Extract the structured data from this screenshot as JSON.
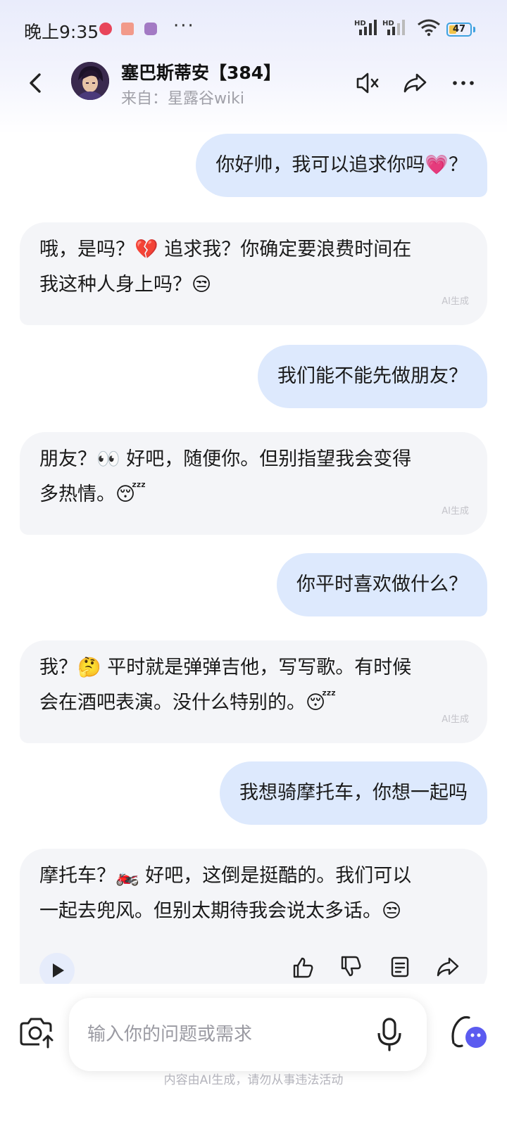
{
  "status_bar": {
    "time": "晚上9:35",
    "signal1_label": "HD",
    "signal2_label": "HD",
    "battery": "47",
    "more": "···"
  },
  "header": {
    "title": "塞巴斯蒂安【384】",
    "subtitle": "来自：星露谷wiki"
  },
  "messages": [
    {
      "role": "user",
      "text": "你好帅，我可以追求你吗💗？"
    },
    {
      "role": "bot",
      "lines": [
        "哦，是吗？💔 追求我？你确定要浪费时间在",
        "我这种人身上吗？😒"
      ],
      "tag": "AI生成"
    },
    {
      "role": "user",
      "text": "我们能不能先做朋友？"
    },
    {
      "role": "bot",
      "lines": [
        "朋友？👀 好吧，随便你。但别指望我会变得",
        "多热情。😴"
      ],
      "tag": "AI生成"
    },
    {
      "role": "user",
      "text": "你平时喜欢做什么？"
    },
    {
      "role": "bot",
      "lines": [
        "我？🤔 平时就是弹弹吉他，写写歌。有时候",
        "会在酒吧表演。没什么特别的。😴"
      ],
      "tag": "AI生成"
    },
    {
      "role": "user",
      "text": "我想骑摩托车，你想一起吗"
    },
    {
      "role": "bot",
      "lines": [
        "摩托车？🏍️ 好吧，这倒是挺酷的。我们可以",
        "一起去兜风。但别太期待我会说太多话。😒"
      ]
    }
  ],
  "input": {
    "placeholder": "输入你的问题或需求"
  },
  "disclaimer": "内容由AI生成，请勿从事违法活动",
  "colors": {
    "user_bubble": "#dde9fd",
    "bot_bubble": "#f4f5f8",
    "accent": "#5b5bf0"
  }
}
